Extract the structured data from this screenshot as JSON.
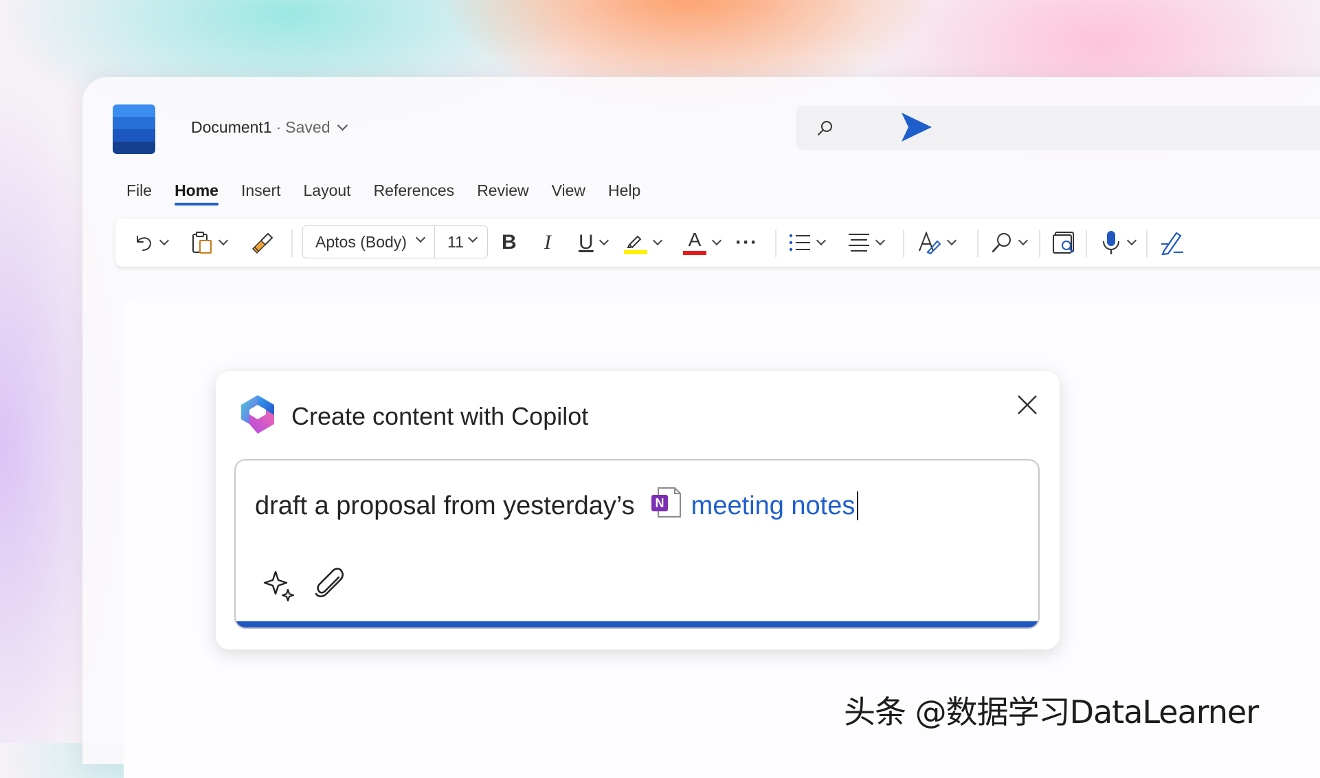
{
  "window": {
    "document_name": "Document1",
    "separator": "·",
    "save_status": "Saved"
  },
  "colors": {
    "accent": "#1f5fcc",
    "logo_blue": [
      "#3b8ef0",
      "#2670d8",
      "#1b57be",
      "#14408f"
    ],
    "highlight_bar": "#ffef00",
    "font_color_bar": "#e31b1b",
    "onenote_purple": "#7b2fb2"
  },
  "menu_tabs": [
    "File",
    "Home",
    "Insert",
    "Layout",
    "References",
    "Review",
    "View",
    "Help"
  ],
  "active_tab": "Home",
  "ribbon": {
    "font_name": "Aptos (Body)",
    "font_size": "11",
    "bold_label": "B",
    "italic_label": "I",
    "underline_label": "U",
    "font_color_label": "A",
    "more_label": "···",
    "icons": [
      "undo-icon",
      "paste-icon",
      "format-painter-icon",
      "bold-icon",
      "italic-icon",
      "underline-icon",
      "highlight-icon",
      "font-color-icon",
      "more-icon",
      "bullets-icon",
      "align-icon",
      "styles-icon",
      "find-icon",
      "immersive-reader-icon",
      "dictate-icon",
      "editor-icon"
    ]
  },
  "copilot": {
    "title": "Create content with Copilot",
    "prompt_text": "draft a proposal from yesterday’s",
    "mention_text": "meeting notes",
    "onenote_letter": "N"
  },
  "watermark": "头条 @数据学习DataLearner"
}
